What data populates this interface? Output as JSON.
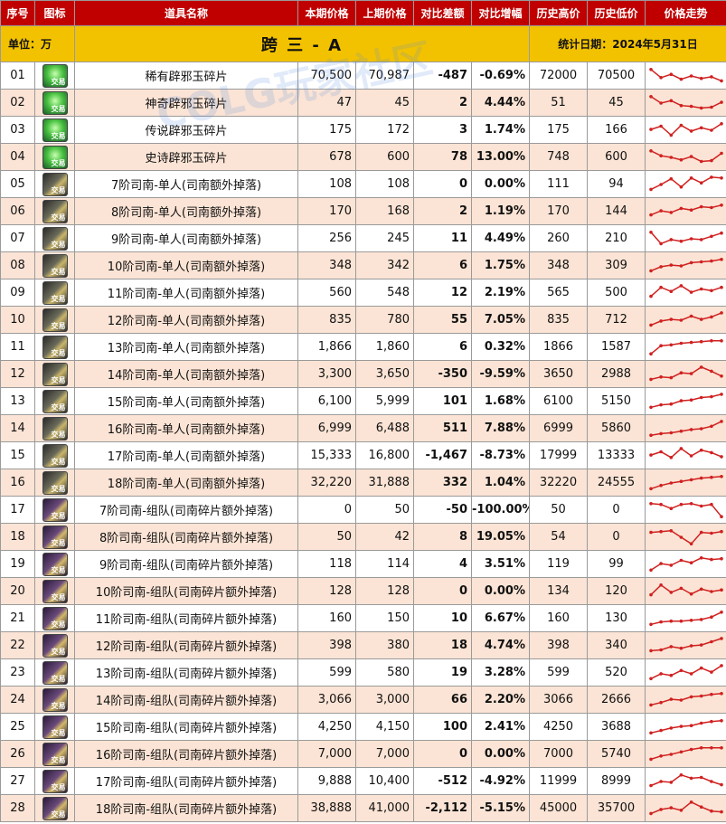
{
  "header": {
    "unit": "单位：万",
    "title": "跨 三 - A",
    "date": "统计日期：2024年5月31日"
  },
  "columns": [
    "序号",
    "图标",
    "道具名称",
    "本期价格",
    "上期价格",
    "对比差额",
    "对比增幅",
    "历史高价",
    "历史低价",
    "价格走势"
  ],
  "watermark": "COLG玩家社区",
  "icon_badge": "交易",
  "colors": {
    "header_bg": "#f2c200",
    "column_header_bg": "#c00000",
    "row_alt_bg": "#fbe4d5",
    "up": "#c00000",
    "down": "#10a050",
    "sparkline": "#d02020"
  },
  "rows": [
    {
      "no": "01",
      "icon": "green-jade-fragment-icon",
      "name": "稀有辟邪玉碎片",
      "cur": "70,500",
      "prev": "70,987",
      "diff": "-487",
      "pct": "-0.69%",
      "high": "72000",
      "low": "70500",
      "dir": "neg",
      "trend": [
        0.9,
        0.4,
        0.6,
        0.3,
        0.5,
        0.35,
        0.45,
        0.2
      ]
    },
    {
      "no": "02",
      "icon": "green-jade-fragment-icon",
      "name": "神奇辟邪玉碎片",
      "cur": "47",
      "prev": "45",
      "diff": "2",
      "pct": "4.44%",
      "high": "51",
      "low": "45",
      "dir": "pos",
      "trend": [
        0.9,
        0.5,
        0.65,
        0.35,
        0.3,
        0.2,
        0.25,
        0.55
      ]
    },
    {
      "no": "03",
      "icon": "green-jade-fragment-icon",
      "name": "传说辟邪玉碎片",
      "cur": "175",
      "prev": "172",
      "diff": "3",
      "pct": "1.74%",
      "high": "175",
      "low": "166",
      "dir": "pos",
      "trend": [
        0.55,
        0.75,
        0.2,
        0.8,
        0.45,
        0.65,
        0.5,
        0.9
      ]
    },
    {
      "no": "04",
      "icon": "green-jade-fragment-icon",
      "name": "史诗辟邪玉碎片",
      "cur": "678",
      "prev": "600",
      "diff": "78",
      "pct": "13.00%",
      "high": "748",
      "low": "600",
      "dir": "pos",
      "trend": [
        0.9,
        0.6,
        0.5,
        0.35,
        0.55,
        0.25,
        0.3,
        0.75
      ]
    },
    {
      "no": "05",
      "icon": "sinan-solo-icon",
      "name": "7阶司南-单人(司南额外掉落)",
      "cur": "108",
      "prev": "108",
      "diff": "0",
      "pct": "0.00%",
      "high": "111",
      "low": "94",
      "dir": "zero",
      "trend": [
        0.2,
        0.5,
        0.85,
        0.35,
        0.9,
        0.6,
        0.95,
        0.9
      ]
    },
    {
      "no": "06",
      "icon": "sinan-solo-icon",
      "name": "8阶司南-单人(司南额外掉落)",
      "cur": "170",
      "prev": "168",
      "diff": "2",
      "pct": "1.19%",
      "high": "170",
      "low": "144",
      "dir": "pos",
      "trend": [
        0.3,
        0.55,
        0.45,
        0.7,
        0.6,
        0.8,
        0.75,
        0.9
      ]
    },
    {
      "no": "07",
      "icon": "sinan-solo-icon",
      "name": "9阶司南-单人(司南额外掉落)",
      "cur": "256",
      "prev": "245",
      "diff": "11",
      "pct": "4.49%",
      "high": "260",
      "low": "210",
      "dir": "pos",
      "trend": [
        0.9,
        0.2,
        0.45,
        0.35,
        0.5,
        0.45,
        0.65,
        0.85
      ]
    },
    {
      "no": "08",
      "icon": "sinan-solo-icon",
      "name": "10阶司南-单人(司南额外掉落)",
      "cur": "348",
      "prev": "342",
      "diff": "6",
      "pct": "1.75%",
      "high": "348",
      "low": "309",
      "dir": "pos",
      "trend": [
        0.2,
        0.45,
        0.55,
        0.5,
        0.7,
        0.75,
        0.8,
        0.9
      ]
    },
    {
      "no": "09",
      "icon": "sinan-solo-icon",
      "name": "11阶司南-单人(司南额外掉落)",
      "cur": "560",
      "prev": "548",
      "diff": "12",
      "pct": "2.19%",
      "high": "565",
      "low": "500",
      "dir": "pos",
      "trend": [
        0.3,
        0.85,
        0.6,
        0.95,
        0.55,
        0.75,
        0.65,
        0.85
      ]
    },
    {
      "no": "10",
      "icon": "sinan-solo-icon",
      "name": "12阶司南-单人(司南额外掉落)",
      "cur": "835",
      "prev": "780",
      "diff": "55",
      "pct": "7.05%",
      "high": "835",
      "low": "712",
      "dir": "pos",
      "trend": [
        0.2,
        0.45,
        0.55,
        0.5,
        0.75,
        0.55,
        0.7,
        0.95
      ]
    },
    {
      "no": "11",
      "icon": "sinan-solo-icon",
      "name": "13阶司南-单人(司南额外掉落)",
      "cur": "1,866",
      "prev": "1,860",
      "diff": "6",
      "pct": "0.32%",
      "high": "1866",
      "low": "1587",
      "dir": "pos",
      "trend": [
        0.1,
        0.6,
        0.65,
        0.75,
        0.8,
        0.85,
        0.9,
        0.9
      ]
    },
    {
      "no": "12",
      "icon": "sinan-solo-icon",
      "name": "14阶司南-单人(司南额外掉落)",
      "cur": "3,300",
      "prev": "3,650",
      "diff": "-350",
      "pct": "-9.59%",
      "high": "3650",
      "low": "2988",
      "dir": "neg",
      "trend": [
        0.2,
        0.35,
        0.3,
        0.6,
        0.55,
        0.95,
        0.7,
        0.4
      ]
    },
    {
      "no": "13",
      "icon": "sinan-solo-icon",
      "name": "15阶司南-单人(司南额外掉落)",
      "cur": "6,100",
      "prev": "5,999",
      "diff": "101",
      "pct": "1.68%",
      "high": "6100",
      "low": "5150",
      "dir": "pos",
      "trend": [
        0.15,
        0.3,
        0.35,
        0.55,
        0.6,
        0.75,
        0.8,
        0.95
      ]
    },
    {
      "no": "14",
      "icon": "sinan-solo-icon",
      "name": "16阶司南-单人(司南额外掉落)",
      "cur": "6,999",
      "prev": "6,488",
      "diff": "511",
      "pct": "7.88%",
      "high": "6999",
      "low": "5860",
      "dir": "pos",
      "trend": [
        0.1,
        0.2,
        0.25,
        0.35,
        0.45,
        0.5,
        0.65,
        0.95
      ]
    },
    {
      "no": "15",
      "icon": "sinan-solo-icon",
      "name": "17阶司南-单人(司南额外掉落)",
      "cur": "15,333",
      "prev": "16,800",
      "diff": "-1,467",
      "pct": "-8.73%",
      "high": "17999",
      "low": "13333",
      "dir": "neg",
      "trend": [
        0.55,
        0.75,
        0.4,
        0.95,
        0.5,
        0.85,
        0.7,
        0.45
      ]
    },
    {
      "no": "16",
      "icon": "sinan-solo-icon",
      "name": "18阶司南-单人(司南额外掉落)",
      "cur": "32,220",
      "prev": "31,888",
      "diff": "332",
      "pct": "1.04%",
      "high": "32220",
      "low": "24555",
      "dir": "pos",
      "trend": [
        0.15,
        0.35,
        0.5,
        0.6,
        0.7,
        0.8,
        0.85,
        0.9
      ]
    },
    {
      "no": "17",
      "icon": "sinan-team-icon",
      "name": "7阶司南-组队(司南碎片额外掉落)",
      "cur": "0",
      "prev": "50",
      "diff": "-50",
      "pct": "-100.00%",
      "high": "50",
      "low": "0",
      "dir": "neg",
      "trend": [
        0.9,
        0.85,
        0.6,
        0.85,
        0.9,
        0.75,
        0.85,
        0.1
      ]
    },
    {
      "no": "18",
      "icon": "sinan-team-icon",
      "name": "8阶司南-组队(司南碎片额外掉落)",
      "cur": "50",
      "prev": "42",
      "diff": "8",
      "pct": "19.05%",
      "high": "54",
      "low": "0",
      "dir": "pos",
      "trend": [
        0.8,
        0.85,
        0.9,
        0.5,
        0.1,
        0.8,
        0.75,
        0.85
      ]
    },
    {
      "no": "19",
      "icon": "sinan-team-icon",
      "name": "9阶司南-组队(司南碎片额外掉落)",
      "cur": "118",
      "prev": "114",
      "diff": "4",
      "pct": "3.51%",
      "high": "119",
      "low": "99",
      "dir": "pos",
      "trend": [
        0.15,
        0.55,
        0.45,
        0.75,
        0.6,
        0.9,
        0.8,
        0.85
      ]
    },
    {
      "no": "20",
      "icon": "sinan-team-icon",
      "name": "10阶司南-组队(司南碎片额外掉落)",
      "cur": "128",
      "prev": "128",
      "diff": "0",
      "pct": "0.00%",
      "high": "134",
      "low": "120",
      "dir": "zero",
      "trend": [
        0.3,
        0.9,
        0.45,
        0.7,
        0.35,
        0.65,
        0.5,
        0.6
      ]
    },
    {
      "no": "21",
      "icon": "sinan-team-icon",
      "name": "11阶司南-组队(司南碎片额外掉落)",
      "cur": "160",
      "prev": "150",
      "diff": "10",
      "pct": "6.67%",
      "high": "160",
      "low": "130",
      "dir": "pos",
      "trend": [
        0.15,
        0.3,
        0.35,
        0.35,
        0.4,
        0.45,
        0.6,
        0.9
      ]
    },
    {
      "no": "22",
      "icon": "sinan-team-icon",
      "name": "12阶司南-组队(司南碎片额外掉落)",
      "cur": "398",
      "prev": "380",
      "diff": "18",
      "pct": "4.74%",
      "high": "398",
      "low": "340",
      "dir": "pos",
      "trend": [
        0.2,
        0.25,
        0.45,
        0.35,
        0.5,
        0.55,
        0.75,
        0.95
      ]
    },
    {
      "no": "23",
      "icon": "sinan-team-icon",
      "name": "13阶司南-组队(司南碎片额外掉落)",
      "cur": "599",
      "prev": "580",
      "diff": "19",
      "pct": "3.28%",
      "high": "599",
      "low": "520",
      "dir": "pos",
      "trend": [
        0.15,
        0.45,
        0.35,
        0.65,
        0.45,
        0.8,
        0.55,
        0.95
      ]
    },
    {
      "no": "24",
      "icon": "sinan-team-icon",
      "name": "14阶司南-组队(司南碎片额外掉落)",
      "cur": "3,066",
      "prev": "3,000",
      "diff": "66",
      "pct": "2.20%",
      "high": "3066",
      "low": "2666",
      "dir": "pos",
      "trend": [
        0.2,
        0.35,
        0.55,
        0.5,
        0.7,
        0.75,
        0.85,
        0.9
      ]
    },
    {
      "no": "25",
      "icon": "sinan-team-icon",
      "name": "15阶司南-组队(司南碎片额外掉落)",
      "cur": "4,250",
      "prev": "4,150",
      "diff": "100",
      "pct": "2.41%",
      "high": "4250",
      "low": "3688",
      "dir": "pos",
      "trend": [
        0.15,
        0.3,
        0.45,
        0.55,
        0.6,
        0.75,
        0.85,
        0.9
      ]
    },
    {
      "no": "26",
      "icon": "sinan-team-icon",
      "name": "16阶司南-组队(司南碎片额外掉落)",
      "cur": "7,000",
      "prev": "7,000",
      "diff": "0",
      "pct": "0.00%",
      "high": "7000",
      "low": "5740",
      "dir": "zero",
      "trend": [
        0.2,
        0.4,
        0.5,
        0.65,
        0.8,
        0.9,
        0.9,
        0.9
      ]
    },
    {
      "no": "27",
      "icon": "sinan-team-icon",
      "name": "17阶司南-组队(司南碎片额外掉落)",
      "cur": "9,888",
      "prev": "10,400",
      "diff": "-512",
      "pct": "-4.92%",
      "high": "11999",
      "low": "8999",
      "dir": "neg",
      "trend": [
        0.25,
        0.5,
        0.45,
        0.9,
        0.7,
        0.75,
        0.5,
        0.3
      ]
    },
    {
      "no": "28",
      "icon": "sinan-team-icon",
      "name": "18阶司南-组队(司南碎片额外掉落)",
      "cur": "38,888",
      "prev": "41,000",
      "diff": "-2,112",
      "pct": "-5.15%",
      "high": "45000",
      "low": "35700",
      "dir": "neg",
      "trend": [
        0.2,
        0.45,
        0.55,
        0.4,
        0.9,
        0.6,
        0.35,
        0.3
      ]
    }
  ]
}
